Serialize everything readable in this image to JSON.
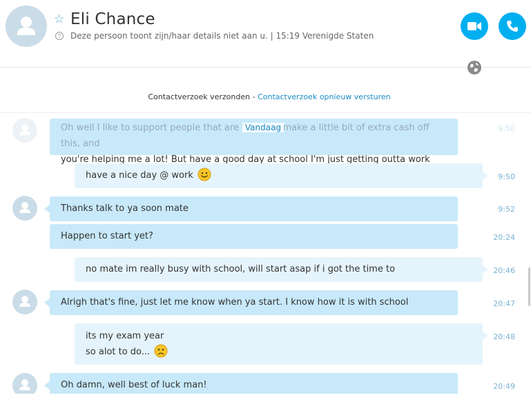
{
  "contact": {
    "name": "Eli Chance",
    "status": "Deze persoon toont zijn/haar details niet aan u.  |  15:19 Verenigde Staten"
  },
  "request": {
    "text": "Contactverzoek verzonden - ",
    "link": "Contactverzoek opnieuw versturen"
  },
  "day_header": "Vandaag",
  "messages": [
    {
      "text": "Oh well I like to support people that are trying to make a little bit of extra  cash off this, and",
      "time": "9:50"
    },
    {
      "text": "you're helping me a lot! But have a good day at school I'm just getting outta work",
      "time": ""
    },
    {
      "text": "have a nice day @ work",
      "time": "9:50"
    },
    {
      "text": "Thanks talk to ya soon  mate",
      "time": "9:52"
    },
    {
      "text": "Happen to start yet?",
      "time": "20:24"
    },
    {
      "text": "no mate im really busy with school, will start asap if i got the time to",
      "time": "20:46"
    },
    {
      "text": "Alrigh that's fine, just let me know when ya start. I know how it is with school",
      "time": "20:47"
    },
    {
      "text": "its my exam year",
      "time": "20:48"
    },
    {
      "text": "so alot to do...",
      "time": ""
    },
    {
      "text": "Oh damn, well best of luck man!",
      "time": "20:49"
    }
  ],
  "icons": {
    "video": "video-camera-icon",
    "call": "phone-icon",
    "favorite": "star-icon",
    "info": "info-icon",
    "globe": "globe-icon",
    "smile": "smile-emoji",
    "sad": "sad-emoji"
  },
  "colors": {
    "accent": "#00aff0",
    "incoming_bubble": "#c8e9fa",
    "outgoing_bubble": "#e5f4fc",
    "link": "#1a8bc4",
    "timestamp": "#7ab3d3"
  }
}
